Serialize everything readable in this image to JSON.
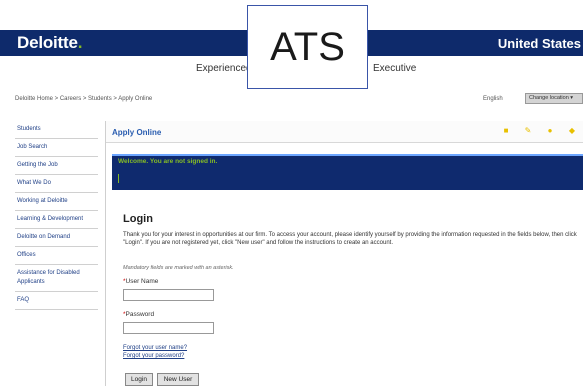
{
  "header": {
    "logo_text": "Deloitte",
    "logo_dot": ".",
    "country": "United States"
  },
  "overlay": {
    "label": "ATS"
  },
  "menu": {
    "left": "Experienced",
    "right": "Executive"
  },
  "breadcrumb": "Deloitte Home > Careers > Students > Apply Online",
  "language": "English",
  "location_button": "Change location ▾",
  "sidebar": {
    "items": [
      {
        "label": "Students"
      },
      {
        "label": "Job Search"
      },
      {
        "label": "Getting the Job"
      },
      {
        "label": "What We Do"
      },
      {
        "label": "Working at Deloitte"
      },
      {
        "label": "Learning & Development"
      },
      {
        "label": "Deloitte on Demand"
      },
      {
        "label": "Offices"
      },
      {
        "label": "Assistance for Disabled Applicants"
      },
      {
        "label": "FAQ"
      }
    ]
  },
  "content": {
    "title": "Apply Online",
    "welcome": "Welcome. You are not signed in.",
    "login_title": "Login",
    "login_desc": "Thank you for your interest in opportunities at our firm. To access your account, please identify yourself by providing the information requested in the fields below, then click \"Login\". If you are not registered yet, click \"New user\" and follow the instructions to create an account.",
    "mandatory_note": "Mandatory fields are marked with an asterisk.",
    "username_label": "User Name",
    "username_value": "",
    "password_label": "Password",
    "password_value": "",
    "forgot_username": "Forgot your user name?",
    "forgot_password": "Forgot your password?",
    "login_button": "Login",
    "new_user_button": "New User"
  },
  "colors": {
    "header_bg": "#0e2a6b",
    "brand_green": "#86bc25",
    "link_blue": "#1f3f86",
    "icon_yellow": "#e8c000"
  }
}
